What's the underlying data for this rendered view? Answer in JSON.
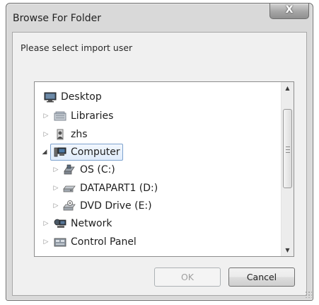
{
  "window": {
    "title": "Browse For Folder",
    "close_label": "X"
  },
  "dialog": {
    "prompt": "Please select import user"
  },
  "tree": {
    "items": [
      {
        "label": "Desktop",
        "icon": "desktop-icon",
        "expander": "none",
        "level": 0,
        "selected": false
      },
      {
        "label": "Libraries",
        "icon": "libraries-icon",
        "expander": "collapsed",
        "level": 1,
        "selected": false
      },
      {
        "label": "zhs",
        "icon": "user-folder-icon",
        "expander": "collapsed",
        "level": 1,
        "selected": false
      },
      {
        "label": "Computer",
        "icon": "computer-icon",
        "expander": "expanded",
        "level": 1,
        "selected": true
      },
      {
        "label": "OS (C:)",
        "icon": "os-drive-icon",
        "expander": "collapsed",
        "level": 2,
        "selected": false
      },
      {
        "label": "DATAPART1 (D:)",
        "icon": "hard-drive-icon",
        "expander": "collapsed",
        "level": 2,
        "selected": false
      },
      {
        "label": "DVD Drive (E:)",
        "icon": "dvd-drive-icon",
        "expander": "collapsed",
        "level": 2,
        "selected": false
      },
      {
        "label": "Network",
        "icon": "network-icon",
        "expander": "collapsed",
        "level": 1,
        "selected": false
      },
      {
        "label": "Control Panel",
        "icon": "control-panel-icon",
        "expander": "collapsed",
        "level": 1,
        "selected": false
      }
    ]
  },
  "buttons": {
    "ok_label": "OK",
    "ok_enabled": false,
    "cancel_label": "Cancel"
  },
  "colors": {
    "selection_border": "#7da2ce",
    "selection_fill": "#e0ecfb"
  }
}
